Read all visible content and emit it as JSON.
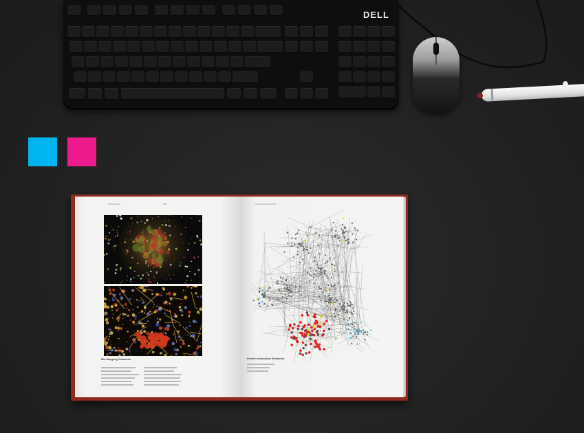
{
  "scene": {
    "keyboard_brand": "DELL",
    "swatch_colors": {
      "cyan": "#00b4f0",
      "magenta": "#ec1a8c"
    },
    "book": {
      "left_caption_title": "Bio-Mapping Networks",
      "right_caption_title": "Protein Interaction Networks"
    }
  },
  "icons": {
    "keyboard": "keyboard-icon",
    "mouse": "mouse-icon",
    "pen": "marker-pen-icon"
  }
}
